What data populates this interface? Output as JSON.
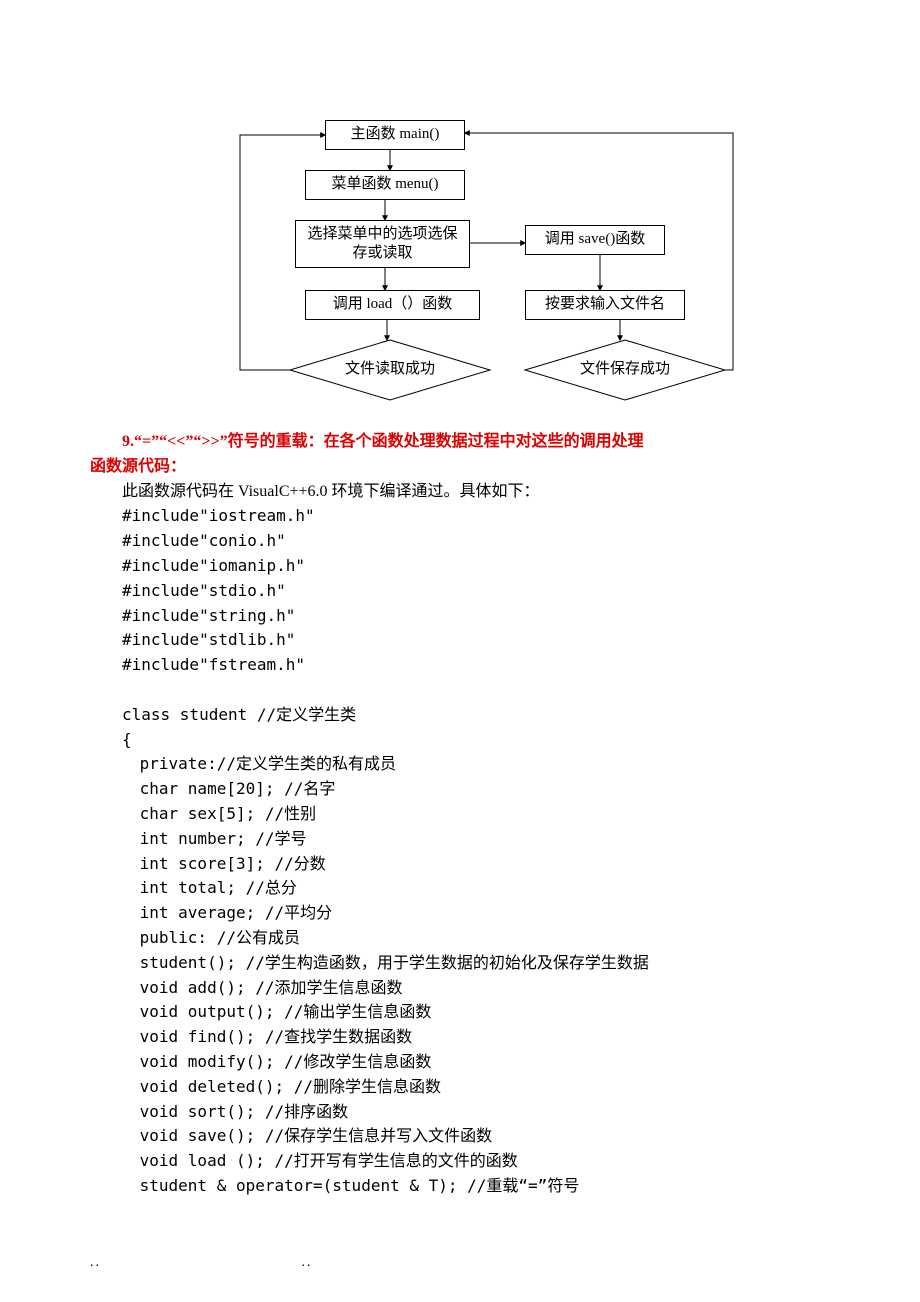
{
  "flow": {
    "main": "主函数 main()",
    "menu": "菜单函数 menu()",
    "choose": "选择菜单中的选项选保存或读取",
    "save_call": "调用 save()函数",
    "load_call": "调用 load（）函数",
    "filename": "按要求输入文件名",
    "read_ok": "文件读取成功",
    "save_ok": "文件保存成功"
  },
  "heading": {
    "line1": "9.“=”“<<”“>>”符号的重载：在各个函数处理数据过程中对这些的调用处理",
    "line2": "函数源代码："
  },
  "intro": "此函数源代码在 VisualC++6.0 环境下编译通过。具体如下：",
  "code": [
    "#include\"iostream.h\"",
    "#include\"conio.h\"",
    "#include\"iomanip.h\"",
    "#include\"stdio.h\"",
    "#include\"string.h\"",
    "#include\"stdlib.h\"",
    "#include\"fstream.h\"",
    "",
    "class student //定义学生类",
    "{",
    " private://定义学生类的私有成员",
    " char name[20]; //名字",
    " char sex[5]; //性别",
    " int number; //学号",
    " int score[3]; //分数",
    " int total; //总分",
    " int average; //平均分",
    " public: //公有成员",
    " student(); //学生构造函数，用于学生数据的初始化及保存学生数据",
    " void add(); //添加学生信息函数",
    " void output(); //输出学生信息函数",
    " void find(); //查找学生数据函数",
    " void modify(); //修改学生信息函数",
    " void deleted(); //删除学生信息函数",
    " void sort(); //排序函数",
    " void save(); //保存学生信息并写入文件函数",
    " void load (); //打开写有学生信息的文件的函数",
    " student & operator=(student & T); //重载“=”符号"
  ],
  "footer": {
    "a": "..",
    "b": ".."
  }
}
